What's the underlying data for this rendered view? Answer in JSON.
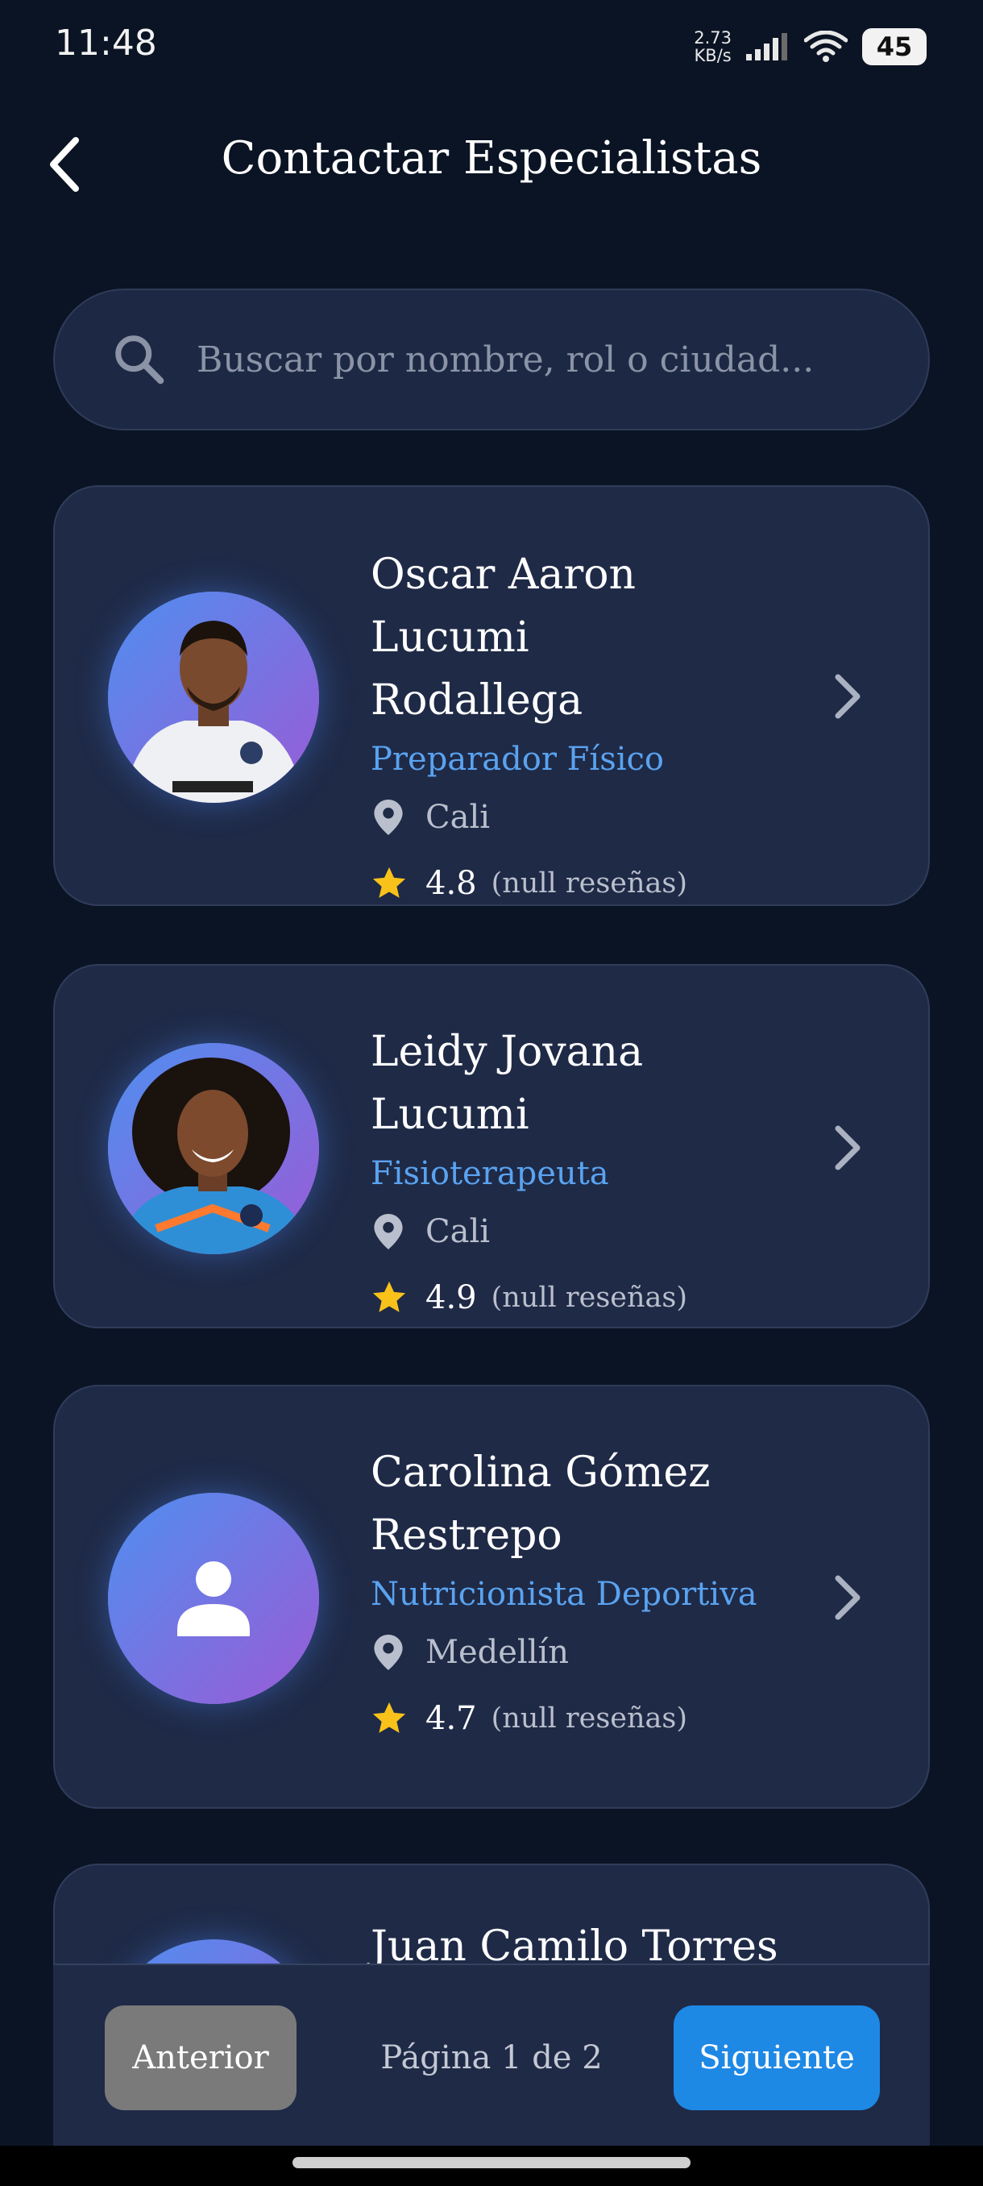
{
  "status_bar": {
    "time": "11:48",
    "net_speed_value": "2.73",
    "net_speed_unit": "KB/s",
    "battery": "45"
  },
  "header": {
    "title": "Contactar Especialistas",
    "back_icon": "chevron-left-icon"
  },
  "search": {
    "placeholder": "Buscar por nombre, rol o ciudad...",
    "value": "",
    "icon": "search-icon"
  },
  "specialists": [
    {
      "name_line1": "Oscar Aaron Lucumi",
      "name_line2": "Rodallega",
      "role": "Preparador Físico",
      "city": "Cali",
      "rating": "4.8",
      "reviews": "(null reseñas)",
      "avatar": "photo"
    },
    {
      "name_line1": "Leidy Jovana Lucumi",
      "name_line2": "",
      "role": "Fisioterapeuta",
      "city": "Cali",
      "rating": "4.9",
      "reviews": "(null reseñas)",
      "avatar": "photo"
    },
    {
      "name_line1": "Carolina Gómez",
      "name_line2": "Restrepo",
      "role": "Nutricionista Deportiva",
      "city": "Medellín",
      "rating": "4.7",
      "reviews": "(null reseñas)",
      "avatar": "person-icon"
    },
    {
      "name_line1": "Juan Camilo Torres",
      "avatar": "partially-visible"
    }
  ],
  "pagination": {
    "prev_label": "Anterior",
    "page_label": "Página 1 de 2",
    "next_label": "Siguiente"
  },
  "colors": {
    "background": "#0b1424",
    "card": "#1f2a47",
    "accent_blue": "#5aa3f0",
    "star": "#f9c21a",
    "next_button": "#1e88e5",
    "prev_button": "#7a7a7a"
  }
}
